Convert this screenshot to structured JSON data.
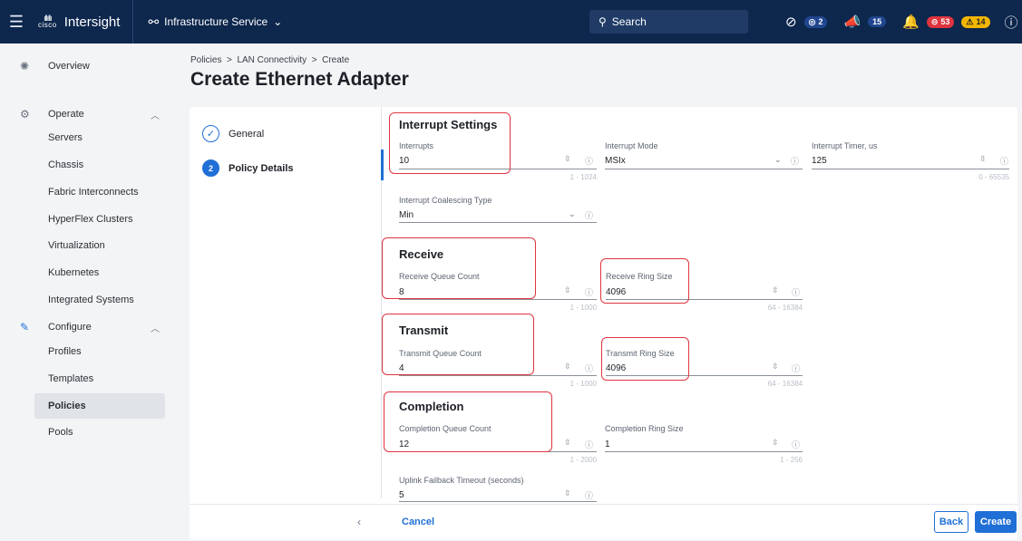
{
  "topbar": {
    "cisco_label": "cisco",
    "brand": "Intersight",
    "service": "Infrastructure Service",
    "search_placeholder": "Search",
    "requests_count": "2",
    "announcements_count": "15",
    "alarms_critical": "53",
    "alarms_warning": "14"
  },
  "sidebar": {
    "overview": "Overview",
    "operate": "Operate",
    "servers": "Servers",
    "chassis": "Chassis",
    "fabric": "Fabric Interconnects",
    "hyperflex": "HyperFlex Clusters",
    "virtualization": "Virtualization",
    "kubernetes": "Kubernetes",
    "integrated": "Integrated Systems",
    "configure": "Configure",
    "profiles": "Profiles",
    "templates": "Templates",
    "policies": "Policies",
    "pools": "Pools"
  },
  "breadcrumb": {
    "crumb1": "Policies",
    "crumb2": "LAN Connectivity",
    "crumb3": "Create",
    "sep": ">"
  },
  "page_title": "Create Ethernet Adapter",
  "steps": {
    "general": "General",
    "policy_details": "Policy Details",
    "step2_number": "2"
  },
  "interrupt": {
    "title": "Interrupt Settings",
    "interrupts_label": "Interrupts",
    "interrupts_value": "10",
    "interrupts_range": "1 - 1024",
    "mode_label": "Interrupt Mode",
    "mode_value": "MSIx",
    "timer_label": "Interrupt Timer, us",
    "timer_value": "125",
    "timer_range": "0 - 65535",
    "coalescing_label": "Interrupt Coalescing Type",
    "coalescing_value": "Min"
  },
  "receive": {
    "title": "Receive",
    "queue_label": "Receive Queue Count",
    "queue_value": "8",
    "queue_range": "1 - 1000",
    "ring_label": "Receive Ring Size",
    "ring_value": "4096",
    "ring_range": "64 - 16384"
  },
  "transmit": {
    "title": "Transmit",
    "queue_label": "Transmit Queue Count",
    "queue_value": "4",
    "queue_range": "1 - 1000",
    "ring_label": "Transmit Ring Size",
    "ring_value": "4096",
    "ring_range": "64 - 16384"
  },
  "completion": {
    "title": "Completion",
    "queue_label": "Completion Queue Count",
    "queue_value": "12",
    "queue_range": "1 - 2000",
    "ring_label": "Completion Ring Size",
    "ring_value": "1",
    "ring_range": "1 - 256"
  },
  "uplink": {
    "label": "Uplink Failback Timeout (seconds)",
    "value": "5"
  },
  "footer": {
    "cancel": "Cancel",
    "back": "Back",
    "create": "Create"
  },
  "colors": {
    "topbar": "#0d274d",
    "accent": "#1f6fd6",
    "highlight": "#e0343e"
  }
}
